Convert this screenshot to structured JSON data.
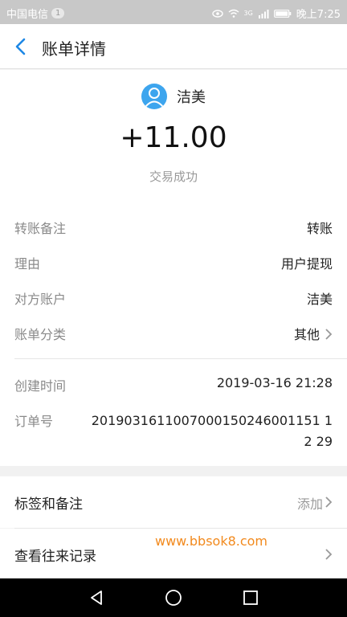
{
  "statusbar": {
    "carrier": "中国电信",
    "notification_count": "1",
    "time": "晚上7:25",
    "network": "3G"
  },
  "header": {
    "title": "账单详情"
  },
  "transaction": {
    "payer_name": "洁美",
    "amount": "+11.00",
    "status": "交易成功"
  },
  "details": [
    {
      "key": "转账备注",
      "value": "转账"
    },
    {
      "key": "理由",
      "value": "用户提现"
    },
    {
      "key": "对方账户",
      "value": "洁美"
    },
    {
      "key": "账单分类",
      "value": "其他"
    }
  ],
  "meta": {
    "created_label": "创建时间",
    "created_value": "2019-03-16 21:28",
    "order_label": "订单号",
    "order_value": "2019031611007000150246001151 12 29"
  },
  "actions": {
    "tags_label": "标签和备注",
    "tags_hint": "添加",
    "history_label": "查看往来记录"
  },
  "watermark": "www.bbsok8.com",
  "colors": {
    "accent": "#1e88e5",
    "avatar": "#3da5ee",
    "watermark": "#f28a1e"
  }
}
